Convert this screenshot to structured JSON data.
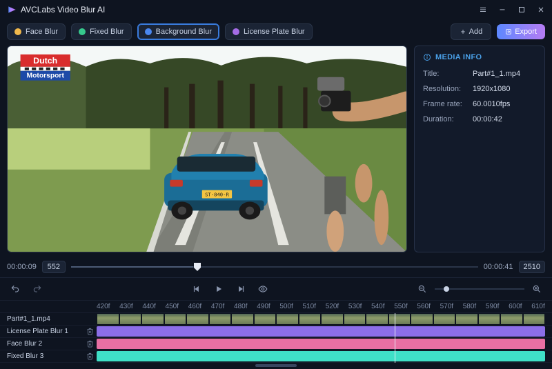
{
  "app": {
    "title": "AVCLabs Video Blur AI"
  },
  "toolbar": {
    "tabs": [
      {
        "label": "Face Blur",
        "color": "yellow"
      },
      {
        "label": "Fixed Blur",
        "color": "green"
      },
      {
        "label": "Background Blur",
        "color": "blue",
        "active": true
      },
      {
        "label": "License Plate Blur",
        "color": "purple"
      }
    ],
    "add_label": "Add",
    "export_label": "Export"
  },
  "media_info": {
    "header": "MEDIA INFO",
    "rows": {
      "title": {
        "label": "Title:",
        "value": "Part#1_1.mp4"
      },
      "resolution": {
        "label": "Resolution:",
        "value": "1920x1080"
      },
      "frame_rate": {
        "label": "Frame rate:",
        "value": "60.0010fps"
      },
      "duration": {
        "label": "Duration:",
        "value": "00:00:42"
      }
    }
  },
  "seek": {
    "current_tc": "00:00:09",
    "current_frame": "552",
    "end_tc": "00:00:41",
    "end_frame": "2510"
  },
  "ruler_ticks": [
    "420f",
    "430f",
    "440f",
    "450f",
    "460f",
    "470f",
    "480f",
    "490f",
    "500f",
    "510f",
    "520f",
    "530f",
    "540f",
    "550f",
    "560f",
    "570f",
    "580f",
    "590f",
    "600f",
    "610f"
  ],
  "tracks": [
    {
      "label": "Part#1_1.mp4",
      "type": "video"
    },
    {
      "label": "License Plate Blur 1",
      "type": "purple"
    },
    {
      "label": "Face Blur 2",
      "type": "pink"
    },
    {
      "label": "Fixed Blur 3",
      "type": "teal"
    }
  ],
  "watermark": {
    "line1": "Dutch",
    "line2": "Motorsport"
  }
}
